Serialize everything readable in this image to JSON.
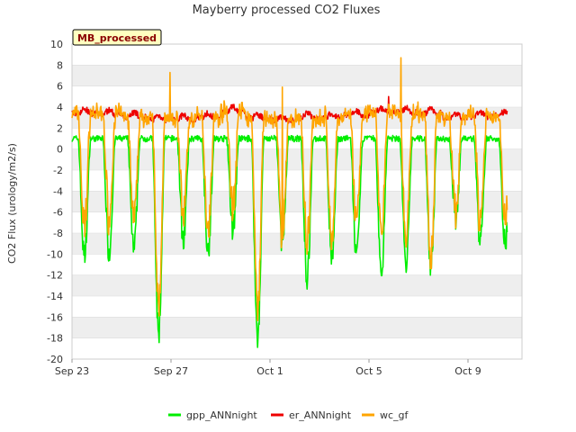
{
  "chart_data": {
    "type": "line",
    "title": "Mayberry processed CO2 Fluxes",
    "ylabel": "CO2 Flux (urology/m2/s)",
    "xlabel": "",
    "badge": "MB_processed",
    "x_domain_days": [
      0,
      19
    ],
    "x_ticks": [
      {
        "day": 0,
        "label": "Sep 23"
      },
      {
        "day": 4,
        "label": "Sep 27"
      },
      {
        "day": 8,
        "label": "Oct 1"
      },
      {
        "day": 12,
        "label": "Oct 5"
      },
      {
        "day": 16,
        "label": "Oct 9"
      }
    ],
    "ylim": [
      -20,
      10
    ],
    "y_ticks": [
      10,
      8,
      6,
      4,
      2,
      0,
      -2,
      -4,
      -6,
      -8,
      -10,
      -12,
      -14,
      -16,
      -18,
      -20
    ],
    "colors": {
      "gpp_ANNnight": "#00ee00",
      "er_ANNnight": "#ee0000",
      "wc_gf": "#ffa500",
      "band": "#eeeeee",
      "grid": "#dddddd",
      "badge_bg": "#ffffc0"
    },
    "daily_series": [
      {
        "day": 0,
        "gpp_min": -10.3,
        "er_mean": 3.4,
        "wc_min": -7.5
      },
      {
        "day": 1,
        "gpp_min": -9.8,
        "er_mean": 3.3,
        "wc_min": -6.5
      },
      {
        "day": 2,
        "gpp_min": -9.7,
        "er_mean": 3.1,
        "wc_min": -7.0
      },
      {
        "day": 3,
        "gpp_min": -17.7,
        "er_mean": 2.8,
        "wc_min": -15.0
      },
      {
        "day": 4,
        "gpp_min": -8.5,
        "er_mean": 2.8,
        "wc_min": -6.0
      },
      {
        "day": 5,
        "gpp_min": -9.5,
        "er_mean": 3.0,
        "wc_min": -7.5
      },
      {
        "day": 6,
        "gpp_min": -7.5,
        "er_mean": 3.6,
        "wc_min": -5.5
      },
      {
        "day": 7,
        "gpp_min": -18.0,
        "er_mean": 2.9,
        "wc_min": -15.0
      },
      {
        "day": 8,
        "gpp_min": -9.0,
        "er_mean": 2.7,
        "wc_min": -8.5
      },
      {
        "day": 9,
        "gpp_min": -12.3,
        "er_mean": 3.0,
        "wc_min": -9.0
      },
      {
        "day": 10,
        "gpp_min": -10.5,
        "er_mean": 3.0,
        "wc_min": -9.0
      },
      {
        "day": 11,
        "gpp_min": -10.5,
        "er_mean": 3.2,
        "wc_min": -7.5
      },
      {
        "day": 12,
        "gpp_min": -12.0,
        "er_mean": 3.5,
        "wc_min": -8.0
      },
      {
        "day": 13,
        "gpp_min": -11.2,
        "er_mean": 3.5,
        "wc_min": -9.0
      },
      {
        "day": 14,
        "gpp_min": -11.0,
        "er_mean": 3.4,
        "wc_min": -10.5
      },
      {
        "day": 15,
        "gpp_min": -6.5,
        "er_mean": 3.0,
        "wc_min": -6.0
      },
      {
        "day": 16,
        "gpp_min": -9.0,
        "er_mean": 3.1,
        "wc_min": -7.5
      },
      {
        "day": 17,
        "gpp_min": -9.0,
        "er_mean": 3.2,
        "wc_min": -6.5
      }
    ],
    "day_end": 17.6,
    "noon_offset": 0.5,
    "spikes": [
      {
        "series": "wc_gf",
        "day": 3.95,
        "value": 7.3
      },
      {
        "series": "wc_gf",
        "day": 8.5,
        "value": 5.9
      },
      {
        "series": "wc_gf",
        "day": 13.3,
        "value": 8.7
      },
      {
        "series": "er_ANNnight",
        "day": 12.8,
        "value": 5.0
      }
    ],
    "legend": {
      "placement": "bottom",
      "entries": [
        "gpp_ANNnight",
        "er_ANNnight",
        "wc_gf"
      ]
    },
    "grid": true
  }
}
